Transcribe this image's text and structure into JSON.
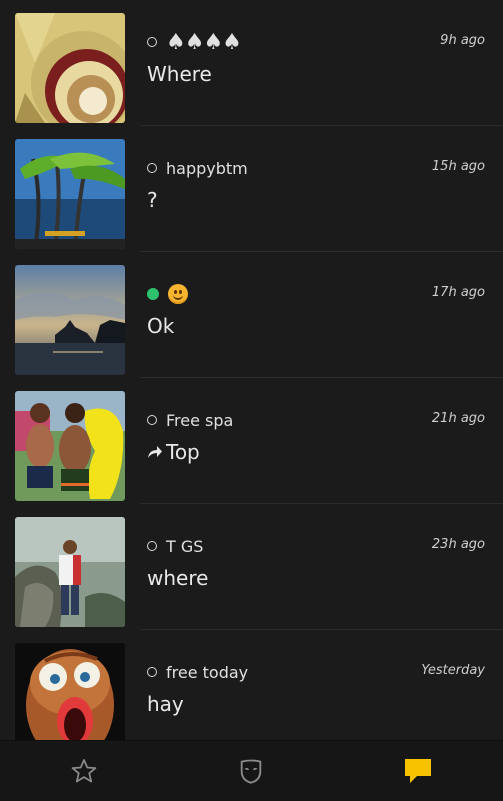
{
  "conversations": [
    {
      "name": "♠♠♠♠",
      "time": "9h ago",
      "message": "Where",
      "status": "offline"
    },
    {
      "name": "happybtm",
      "time": "15h ago",
      "message": "?",
      "status": "offline"
    },
    {
      "name": "😊",
      "time": "17h ago",
      "message": "Ok",
      "status": "online"
    },
    {
      "name": "Free spa",
      "time": "21h ago",
      "message": "Top",
      "status": "offline"
    },
    {
      "name": "T GS",
      "time": "23h ago",
      "message": "where",
      "status": "offline"
    },
    {
      "name": "free today",
      "time": "Yesterday",
      "message": "hay",
      "status": "offline"
    }
  ],
  "bottom_nav": {
    "tabs": [
      {
        "icon": "star-icon",
        "active": false
      },
      {
        "icon": "mask-icon",
        "active": false
      },
      {
        "icon": "chat-bubble-icon",
        "active": true
      }
    ],
    "active_color": "#f7c300",
    "inactive_color": "#8a8a8a"
  },
  "colors": {
    "online": "#2ec26e",
    "background": "#1b1b1b"
  }
}
